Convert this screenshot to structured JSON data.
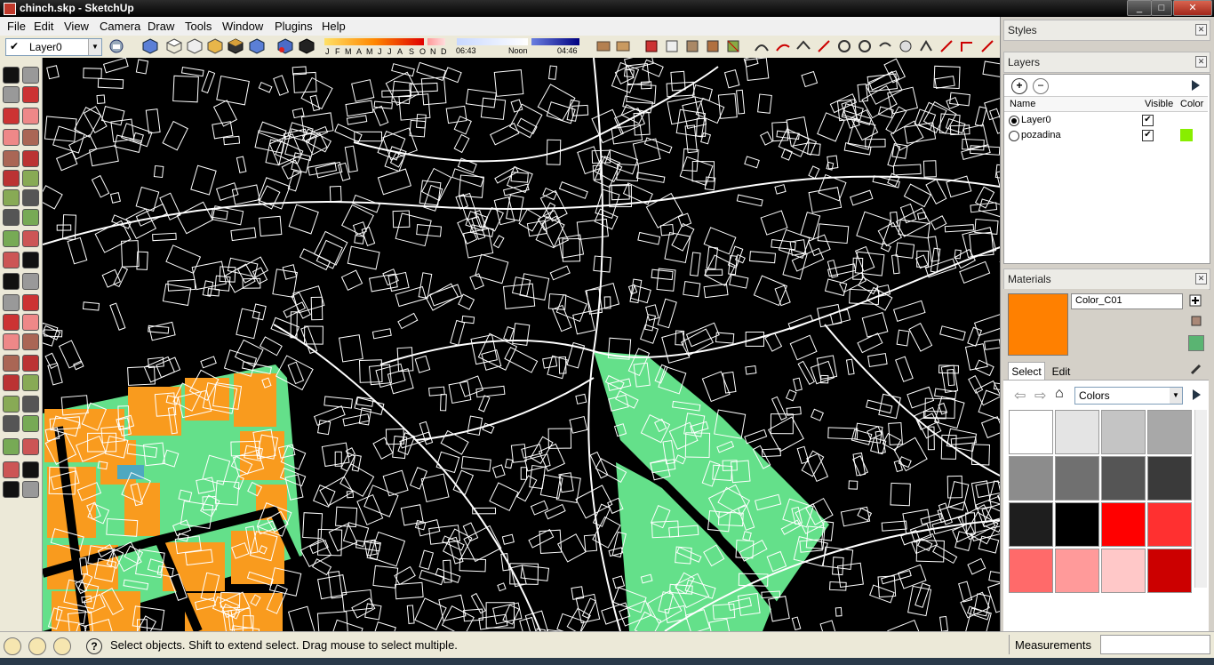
{
  "window": {
    "title": "chinch.skp - SketchUp",
    "controls": [
      "_",
      "□",
      "✕"
    ]
  },
  "menu": [
    "File",
    "Edit",
    "View",
    "Camera",
    "Draw",
    "Tools",
    "Window",
    "Plugins",
    "Help"
  ],
  "toolbar": {
    "layer_selected": "Layer0",
    "months": [
      "J",
      "F",
      "M",
      "A",
      "M",
      "J",
      "J",
      "A",
      "S",
      "O",
      "N",
      "D"
    ],
    "time_start": "06:43",
    "time_noon": "Noon",
    "time_end": "04:46"
  },
  "styles_panel": {
    "title": "Styles"
  },
  "layers_panel": {
    "title": "Layers",
    "columns": {
      "name": "Name",
      "visible": "Visible",
      "color": "Color"
    },
    "layers": [
      {
        "name": "Layer0",
        "active": true,
        "visible": true,
        "color": ""
      },
      {
        "name": "pozadina",
        "active": false,
        "visible": true,
        "color": "#88ee00"
      }
    ]
  },
  "materials_panel": {
    "title": "Materials",
    "current_material": "Color_C01",
    "current_color": "#ff8000",
    "tabs": [
      "Select",
      "Edit"
    ],
    "library": "Colors",
    "swatches": [
      "#ffffff",
      "#e4e4e4",
      "#c4c4c4",
      "#a8a8a8",
      "#8c8c8c",
      "#707070",
      "#555555",
      "#3a3a3a",
      "#1e1e1e",
      "#000000",
      "#ff0000",
      "#ff3030",
      "#ff6a6a",
      "#ff9a9a",
      "#ffc8c8",
      "#cc0000"
    ]
  },
  "status": {
    "message": "Select objects. Shift to extend select. Drag mouse to select multiple.",
    "measurements_label": "Measurements"
  },
  "colors": {
    "canvas": "#000000",
    "building_outline": "#ffffff",
    "orange_fill": "#f99b1e",
    "green_fill": "#64e08a"
  }
}
